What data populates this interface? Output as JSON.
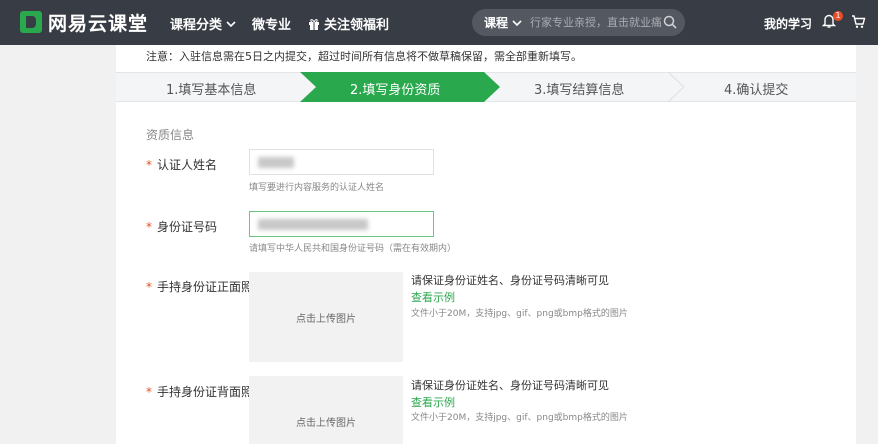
{
  "header": {
    "logo_text": "网易云课堂",
    "nav": [
      {
        "label": "课程分类"
      },
      {
        "label": "微专业"
      },
      {
        "label": "关注领福利"
      }
    ],
    "search": {
      "category": "课程",
      "placeholder": "行家专业亲授，直击就业痛"
    },
    "my_study": "我的学习",
    "notification_count": "1"
  },
  "notice": "注意：入驻信息需在5日之内提交，超过时间所有信息将不做草稿保留，需全部重新填写。",
  "steps": [
    {
      "label": "1.填写基本信息"
    },
    {
      "label": "2.填写身份资质"
    },
    {
      "label": "3.填写结算信息"
    },
    {
      "label": "4.确认提交"
    }
  ],
  "active_step": 2,
  "form": {
    "section_title": "资质信息",
    "required_mark": "*",
    "name": {
      "label": "认证人姓名",
      "hint": "填写要进行内容服务的认证人姓名"
    },
    "id_number": {
      "label": "身份证号码",
      "hint": "请填写中华人民共和国身份证号码（需在有效期内）"
    },
    "id_front": {
      "label": "手持身份证正面照",
      "upload_text": "点击上传图片",
      "info_title": "请保证身份证姓名、身份证号码清晰可见",
      "example_link": "查看示例",
      "file_note": "文件小于20M，支持jpg、gif、png或bmp格式的图片"
    },
    "id_back": {
      "label": "手持身份证背面照",
      "upload_text": "点击上传图片",
      "info_title": "请保证身份证姓名、身份证号码清晰可见",
      "example_link": "查看示例",
      "file_note": "文件小于20M，支持jpg、gif、png或bmp格式的图片"
    }
  },
  "colors": {
    "header_bg": "#383c44",
    "accent_green": "#2aa84e",
    "required_red": "#e94e26"
  }
}
